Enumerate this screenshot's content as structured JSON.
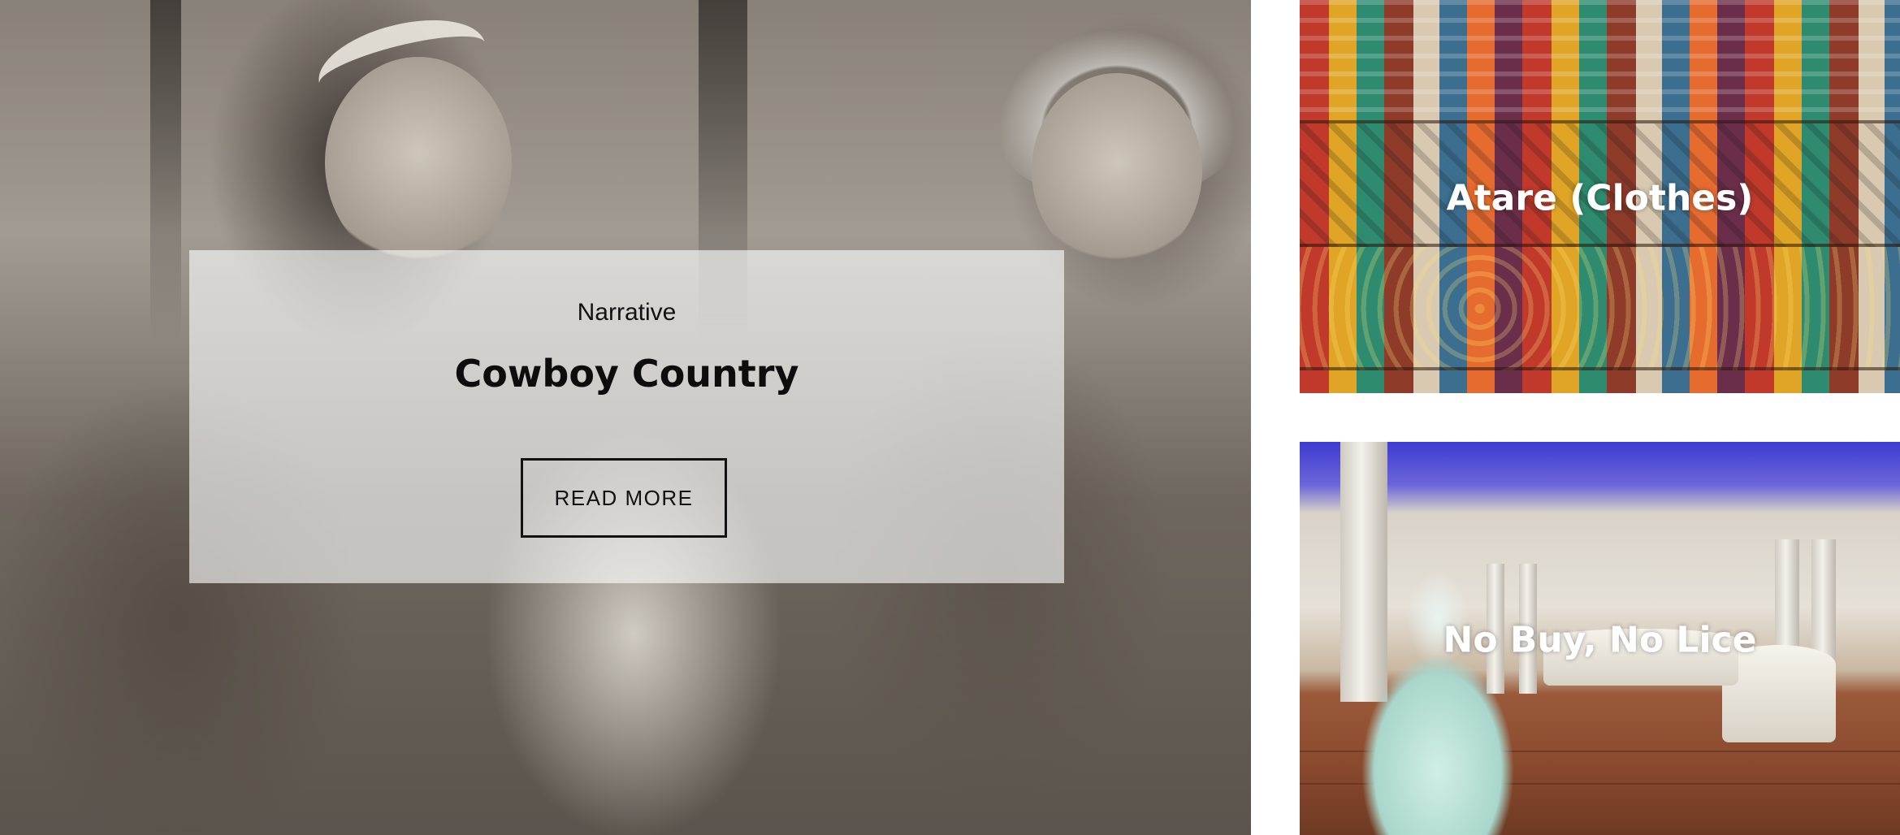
{
  "featured": {
    "category": "Narrative",
    "title": "Cowboy Country",
    "button_label": "READ MORE"
  },
  "side_tiles": [
    {
      "title": "Atare (Clothes)"
    },
    {
      "title": "No Buy, No Lice"
    }
  ]
}
